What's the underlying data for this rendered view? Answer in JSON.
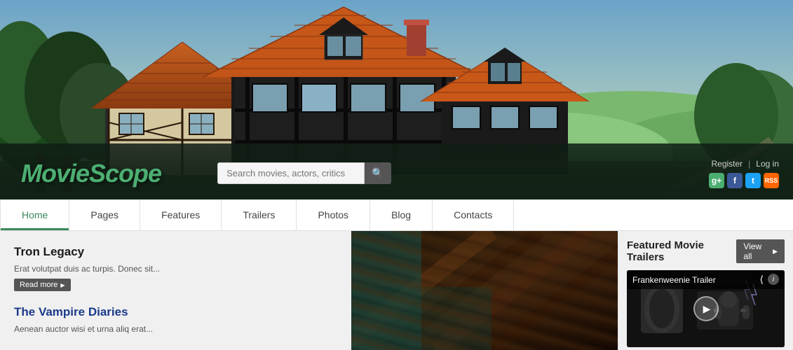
{
  "site": {
    "name": "MovieScope",
    "logo_part1": "Movie",
    "logo_part2": "Scope"
  },
  "header": {
    "search_placeholder": "Search movies, actors, critics",
    "register_label": "Register",
    "login_label": "Log in",
    "social": [
      {
        "name": "google-plus",
        "symbol": "g+",
        "class": "social-google"
      },
      {
        "name": "facebook",
        "symbol": "f",
        "class": "social-facebook"
      },
      {
        "name": "twitter",
        "symbol": "t",
        "class": "social-twitter"
      },
      {
        "name": "rss",
        "symbol": "rss",
        "class": "social-rss"
      }
    ]
  },
  "nav": {
    "items": [
      {
        "label": "Home",
        "active": true
      },
      {
        "label": "Pages",
        "active": false
      },
      {
        "label": "Features",
        "active": false
      },
      {
        "label": "Trailers",
        "active": false
      },
      {
        "label": "Photos",
        "active": false
      },
      {
        "label": "Blog",
        "active": false
      },
      {
        "label": "Contacts",
        "active": false
      }
    ]
  },
  "featured": {
    "movie1": {
      "title": "Tron Legacy",
      "description": "Erat volutpat duis ac turpis. Donec sit...",
      "read_more": "Read more"
    },
    "movie2": {
      "title": "The Vampire Diaries",
      "description": "Aenean auctor wisi et urna aliq erat..."
    }
  },
  "sidebar": {
    "title": "Featured Movie Trailers",
    "view_all": "View all",
    "trailer": {
      "name": "Frankenweenie Trailer",
      "share_icon": "◁",
      "info_icon": "i"
    }
  }
}
